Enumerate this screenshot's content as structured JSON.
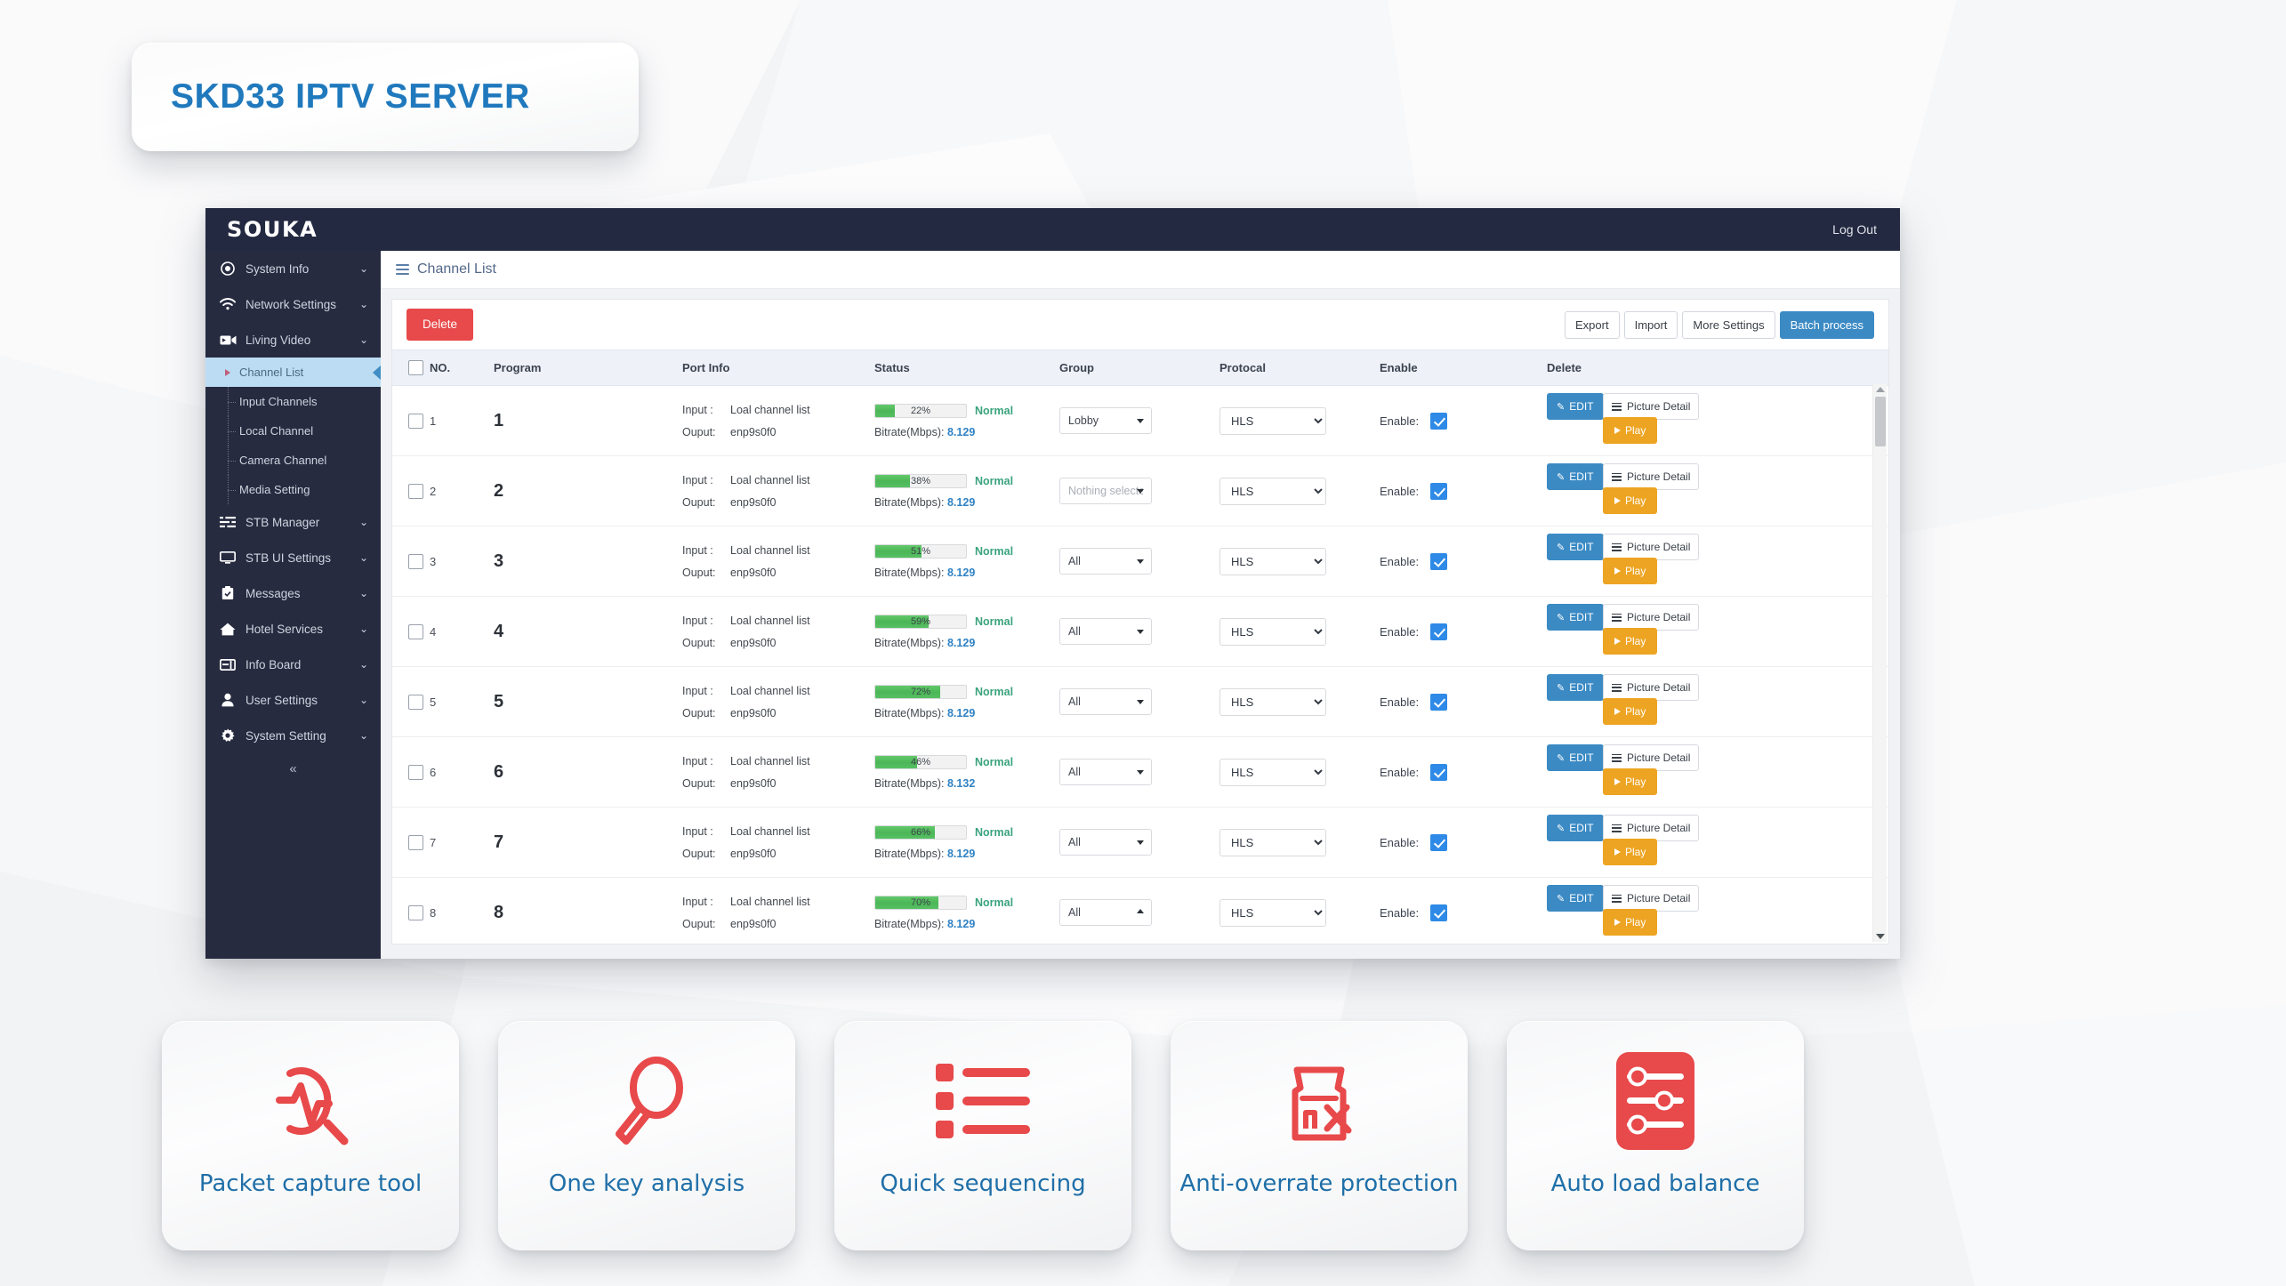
{
  "banner": {
    "title": "SKD33 IPTV SERVER"
  },
  "app": {
    "brand": "SOUKA",
    "logout_label": "Log Out",
    "page_title": "Channel List"
  },
  "sidebar": {
    "collapse_label": "«",
    "items": [
      {
        "label": "System Info",
        "icon": "target-icon",
        "caret": "⌄",
        "type": "group"
      },
      {
        "label": "Network Settings",
        "icon": "wifi-icon",
        "caret": "⌄",
        "type": "group"
      },
      {
        "label": "Living Video",
        "icon": "video-icon",
        "caret": "⌄",
        "type": "group"
      }
    ],
    "sub_items": [
      {
        "label": "Channel List",
        "active": true
      },
      {
        "label": "Input Channels",
        "active": false
      },
      {
        "label": "Local Channel",
        "active": false
      },
      {
        "label": "Camera Channel",
        "active": false
      },
      {
        "label": "Media Setting",
        "active": false
      }
    ],
    "items_tail": [
      {
        "label": "STB Manager",
        "icon": "sliders-icon",
        "caret": "⌄",
        "type": "group"
      },
      {
        "label": "STB UI Settings",
        "icon": "monitor-icon",
        "caret": "⌄",
        "type": "group"
      },
      {
        "label": "Messages",
        "icon": "clipboard-icon",
        "caret": "⌄",
        "type": "group"
      },
      {
        "label": "Hotel Services",
        "icon": "home-icon",
        "caret": "⌄",
        "type": "group"
      },
      {
        "label": "Info Board",
        "icon": "board-icon",
        "caret": "⌄",
        "type": "group"
      },
      {
        "label": "User Settings",
        "icon": "user-icon",
        "caret": "⌄",
        "type": "group"
      },
      {
        "label": "System Setting",
        "icon": "gear-icon",
        "caret": "⌄",
        "type": "group"
      }
    ]
  },
  "toolbar": {
    "delete_label": "Delete",
    "export_label": "Export",
    "import_label": "Import",
    "more_settings_label": "More Settings",
    "batch_process_label": "Batch process"
  },
  "table": {
    "headers": [
      "NO.",
      "Program",
      "Port Info",
      "Status",
      "Group",
      "Protocal",
      "Enable",
      "Delete"
    ],
    "labels": {
      "input": "Input :",
      "output": "Ouput:",
      "bitrate_prefix": "Bitrate(Mbps):",
      "enable": "Enable:",
      "edit": "EDIT",
      "picture_detail": "Picture Detail",
      "play": "Play"
    },
    "rows": [
      {
        "no": "1",
        "program": "1",
        "input": "Loal channel list",
        "output": "enp9s0f0",
        "percent": 22,
        "percent_label": "22%",
        "status": "Normal",
        "bitrate": "8.129",
        "group": "Lobby",
        "group_placeholder": false,
        "group_arrow": "down",
        "protocol": "HLS",
        "enabled": true
      },
      {
        "no": "2",
        "program": "2",
        "input": "Loal channel list",
        "output": "enp9s0f0",
        "percent": 38,
        "percent_label": "38%",
        "status": "Normal",
        "bitrate": "8.129",
        "group": "Nothing selecte",
        "group_placeholder": true,
        "group_arrow": "down",
        "protocol": "HLS",
        "enabled": true
      },
      {
        "no": "3",
        "program": "3",
        "input": "Loal channel list",
        "output": "enp9s0f0",
        "percent": 51,
        "percent_label": "51%",
        "status": "Normal",
        "bitrate": "8.129",
        "group": "All",
        "group_placeholder": false,
        "group_arrow": "down",
        "protocol": "HLS",
        "enabled": true
      },
      {
        "no": "4",
        "program": "4",
        "input": "Loal channel list",
        "output": "enp9s0f0",
        "percent": 59,
        "percent_label": "59%",
        "status": "Normal",
        "bitrate": "8.129",
        "group": "All",
        "group_placeholder": false,
        "group_arrow": "down",
        "protocol": "HLS",
        "enabled": true
      },
      {
        "no": "5",
        "program": "5",
        "input": "Loal channel list",
        "output": "enp9s0f0",
        "percent": 72,
        "percent_label": "72%",
        "status": "Normal",
        "bitrate": "8.129",
        "group": "All",
        "group_placeholder": false,
        "group_arrow": "down",
        "protocol": "HLS",
        "enabled": true
      },
      {
        "no": "6",
        "program": "6",
        "input": "Loal channel list",
        "output": "enp9s0f0",
        "percent": 46,
        "percent_label": "46%",
        "status": "Normal",
        "bitrate": "8.132",
        "group": "All",
        "group_placeholder": false,
        "group_arrow": "down",
        "protocol": "HLS",
        "enabled": true
      },
      {
        "no": "7",
        "program": "7",
        "input": "Loal channel list",
        "output": "enp9s0f0",
        "percent": 66,
        "percent_label": "66%",
        "status": "Normal",
        "bitrate": "8.129",
        "group": "All",
        "group_placeholder": false,
        "group_arrow": "down",
        "protocol": "HLS",
        "enabled": true
      },
      {
        "no": "8",
        "program": "8",
        "input": "Loal channel list",
        "output": "enp9s0f0",
        "percent": 70,
        "percent_label": "70%",
        "status": "Normal",
        "bitrate": "8.129",
        "group": "All",
        "group_placeholder": false,
        "group_arrow": "up",
        "protocol": "HLS",
        "enabled": true
      }
    ],
    "protocol_options": [
      "HLS"
    ]
  },
  "features": [
    {
      "label": "Packet capture tool",
      "icon": "pulse-magnifier-icon"
    },
    {
      "label": "One key analysis",
      "icon": "magnifier-icon"
    },
    {
      "label": "Quick sequencing",
      "icon": "list-icon"
    },
    {
      "label": "Anti-overrate protection",
      "icon": "shield-tools-icon"
    },
    {
      "label": "Auto load balance",
      "icon": "sliders-filled-icon"
    }
  ],
  "colors": {
    "accent_blue": "#2079bd",
    "brand_dark": "#232940",
    "danger_red": "#e8494a",
    "primary_blue": "#3b8ac4",
    "warn_orange": "#eda422",
    "status_green": "#3aa37d",
    "feature_red": "#e8494a",
    "feature_text": "#1f6fa8"
  }
}
